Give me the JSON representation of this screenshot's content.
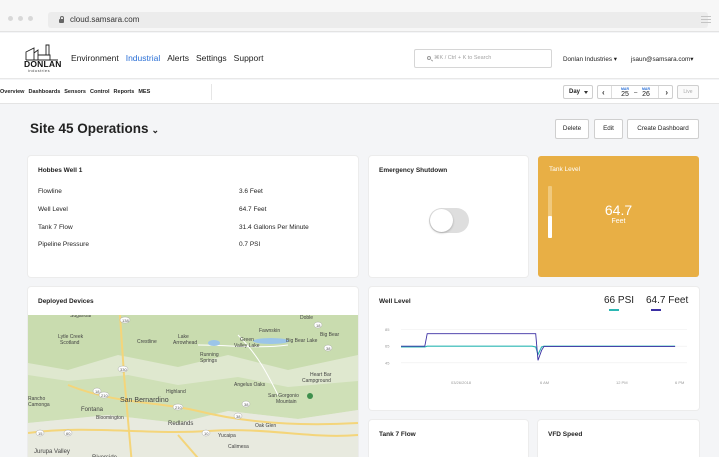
{
  "browser": {
    "url": "cloud.samsara.com"
  },
  "header": {
    "logo_text": "DONLAN",
    "logo_sub": "industries",
    "nav": [
      "Environment",
      "Industrial",
      "Alerts",
      "Settings",
      "Support"
    ],
    "active_nav": "Industrial",
    "search_placeholder": "⌘K / Ctrl + K to Search",
    "org": "Donlan Industries ▾",
    "user": "jsaun@samsara.com▾"
  },
  "subnav": {
    "links": [
      "Overview",
      "Dashboards",
      "Sensors",
      "Control",
      "Reports",
      "MES"
    ],
    "range_label": "Day",
    "date_start": {
      "month": "MAR",
      "day": "25"
    },
    "date_sep": "–",
    "date_end": {
      "month": "MAR",
      "day": "26"
    },
    "live_label": "Live"
  },
  "page": {
    "title": "Site 45 Operations",
    "delete_label": "Delete",
    "edit_label": "Edit",
    "create_label": "Create Dashboard"
  },
  "hobbes": {
    "title": "Hobbes Well 1",
    "rows": [
      {
        "label": "Flowline",
        "value": "3.6 Feet"
      },
      {
        "label": "Well Level",
        "value": "64.7 Feet"
      },
      {
        "label": "Tank 7 Flow",
        "value": "31.4 Gallons Per Minute"
      },
      {
        "label": "Pipeline Pressure",
        "value": "0.7 PSI"
      }
    ]
  },
  "emergency": {
    "title": "Emergency Shutdown",
    "state": "off"
  },
  "tank": {
    "title": "Tank Level",
    "value": "64.7",
    "unit": "Feet",
    "fill_fraction": 0.42,
    "color": "#e8af45"
  },
  "devices": {
    "title": "Deployed Devices",
    "map_labels": [
      "Lytle Creek",
      "Scotland",
      "Crestline",
      "Lake Arrowhead",
      "Green Valley Lake",
      "Fawnskin",
      "Big Bear Lake",
      "Big Bear Lake",
      "Running Springs",
      "Highland",
      "San Bernardino",
      "Fontana",
      "Rancho Cucamonga",
      "Bloomington",
      "Redlands",
      "Yucaipa",
      "Oak Glen",
      "Angelus Oaks",
      "San Gorgonio Mountain",
      "Heart Bar Campground",
      "Calimesa",
      "Jurupa Valley",
      "Riverside",
      "Doble",
      "Sugarloaf"
    ],
    "route_labels": [
      "138",
      "18",
      "38",
      "330",
      "18",
      "210",
      "38",
      "210",
      "38",
      "15",
      "10",
      "60"
    ]
  },
  "well_level": {
    "title": "Well Level",
    "legend": [
      {
        "value": "66 PSI",
        "color": "#2bb7b3"
      },
      {
        "value": "64.7 Feet",
        "color": "#3b2fa3"
      }
    ],
    "y_ticks": [
      "85",
      "65",
      "45"
    ],
    "x_ticks": [
      "03/26/2018",
      "6 AM",
      "12 PM",
      "6 PM"
    ]
  },
  "chart_data": {
    "type": "line",
    "title": "Well Level",
    "xlabel": "",
    "ylabel": "",
    "x_ticks": [
      "03/26/2018",
      "6 AM",
      "12 PM",
      "6 PM"
    ],
    "y_ticks": [
      85,
      65,
      45
    ],
    "ylim": [
      40,
      88
    ],
    "x": [
      0,
      2,
      2.2,
      4,
      8,
      10,
      11,
      11.3,
      11.5,
      11.8,
      12,
      12.5,
      14,
      16,
      18,
      20,
      22,
      23
    ],
    "series": [
      {
        "name": "66 PSI",
        "color": "#2bb7b3",
        "values": [
          64,
          64,
          65,
          65,
          65,
          65,
          65,
          64,
          55,
          64,
          65,
          65,
          65,
          65,
          65,
          65,
          65,
          65
        ]
      },
      {
        "name": "64.7 Feet",
        "color": "#3b2fa3",
        "values": [
          65,
          65,
          80,
          80,
          80,
          80,
          80,
          80,
          48,
          60,
          64.7,
          64.7,
          64.7,
          64.7,
          64.7,
          64.7,
          64.7,
          64.7
        ]
      }
    ]
  },
  "flow": {
    "title": "Tank 7 Flow"
  },
  "vfd": {
    "title": "VFD Speed"
  }
}
